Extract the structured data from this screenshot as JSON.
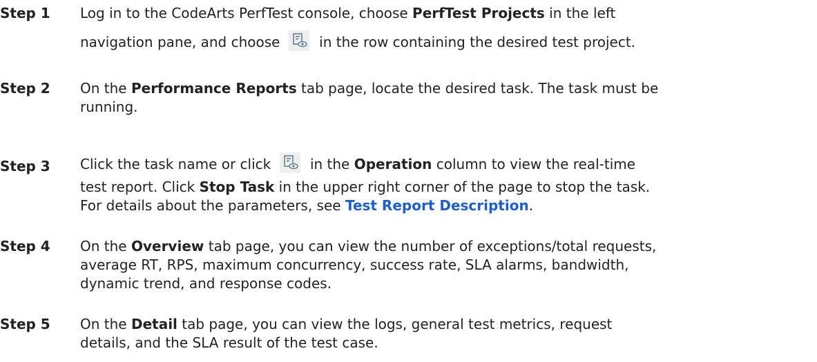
{
  "steps": [
    {
      "label": "Step 1",
      "line1": {
        "pre": "Log in to the CodeArts PerfTest console, choose ",
        "bold": "PerfTest Projects",
        "post": " in the left"
      },
      "line2": {
        "pre": "navigation pane, and choose ",
        "icon": "view-report-icon",
        "post": " in the row containing the desired test project."
      }
    },
    {
      "label": "Step 2",
      "line1": {
        "pre": "On the ",
        "bold": "Performance Reports",
        "post": " tab page, locate the desired task. The task must be"
      },
      "line2": "running."
    },
    {
      "label": "Step 3",
      "line1": {
        "pre": "Click the task name or click ",
        "icon": "view-report-icon",
        "mid": " in the ",
        "bold": "Operation",
        "post": " column to view the real-time"
      },
      "line2": {
        "pre": "test report. Click ",
        "bold": "Stop Task",
        "post": " in the upper right corner of the page to stop the task."
      },
      "line3": {
        "pre": "For details about the parameters, see ",
        "link": "Test Report Description",
        "post": "."
      }
    },
    {
      "label": "Step 4",
      "line1": {
        "pre": "On the ",
        "bold": "Overview",
        "post": " tab page, you can view the number of exceptions/total requests,"
      },
      "line2": "average RT, RPS, maximum concurrency, success rate, SLA alarms, bandwidth,",
      "line3": "dynamic trend, and response codes."
    },
    {
      "label": "Step 5",
      "line1": {
        "pre": "On the ",
        "bold": "Detail",
        "post": " tab page, you can view the logs, general test metrics, request"
      },
      "line2": "details, and the SLA result of the test case."
    }
  ],
  "colors": {
    "text": "#222222",
    "link": "#1a5fd6",
    "icon_bg": "#eeeeee",
    "icon_stroke": "#5a7b8c"
  }
}
